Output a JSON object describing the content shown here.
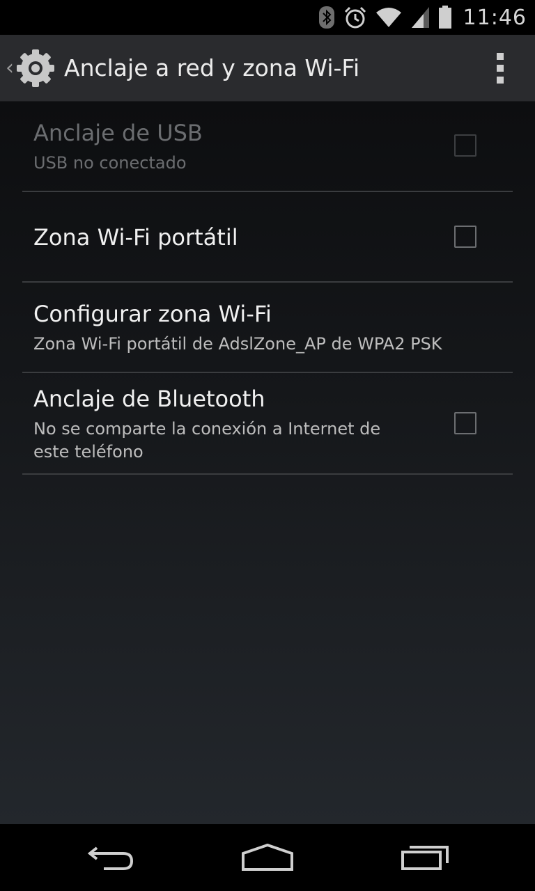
{
  "status_bar": {
    "time": "11:46",
    "icons": [
      "bluetooth-icon",
      "alarm-icon",
      "wifi-icon",
      "signal-icon",
      "battery-icon"
    ]
  },
  "action_bar": {
    "title": "Anclaje a red y zona Wi-Fi",
    "up_icon": "settings-gear-icon",
    "overflow_icon": "overflow-menu-icon"
  },
  "preferences": [
    {
      "title": "Anclaje de USB",
      "summary": "USB no conectado",
      "checkbox": true,
      "checked": false,
      "enabled": false
    },
    {
      "title": "Zona Wi-Fi portátil",
      "checkbox": true,
      "checked": false,
      "enabled": true
    },
    {
      "title": "Configurar zona Wi-Fi",
      "summary": "Zona Wi-Fi portátil de AdslZone_AP de WPA2 PSK",
      "checkbox": false,
      "enabled": true
    },
    {
      "title": "Anclaje de Bluetooth",
      "summary_line1": "No se comparte la conexión a Internet de",
      "summary_line2": "este teléfono",
      "checkbox": true,
      "checked": false,
      "enabled": true
    }
  ],
  "nav_bar": {
    "buttons": [
      "back-icon",
      "home-icon",
      "recents-icon"
    ]
  },
  "colors": {
    "action_bar_bg": "#2a2b2e",
    "divider": "#3a3c3f",
    "text_primary": "#f0f0f0",
    "text_secondary": "#bdbdbd",
    "text_disabled": "#6b6d70"
  }
}
